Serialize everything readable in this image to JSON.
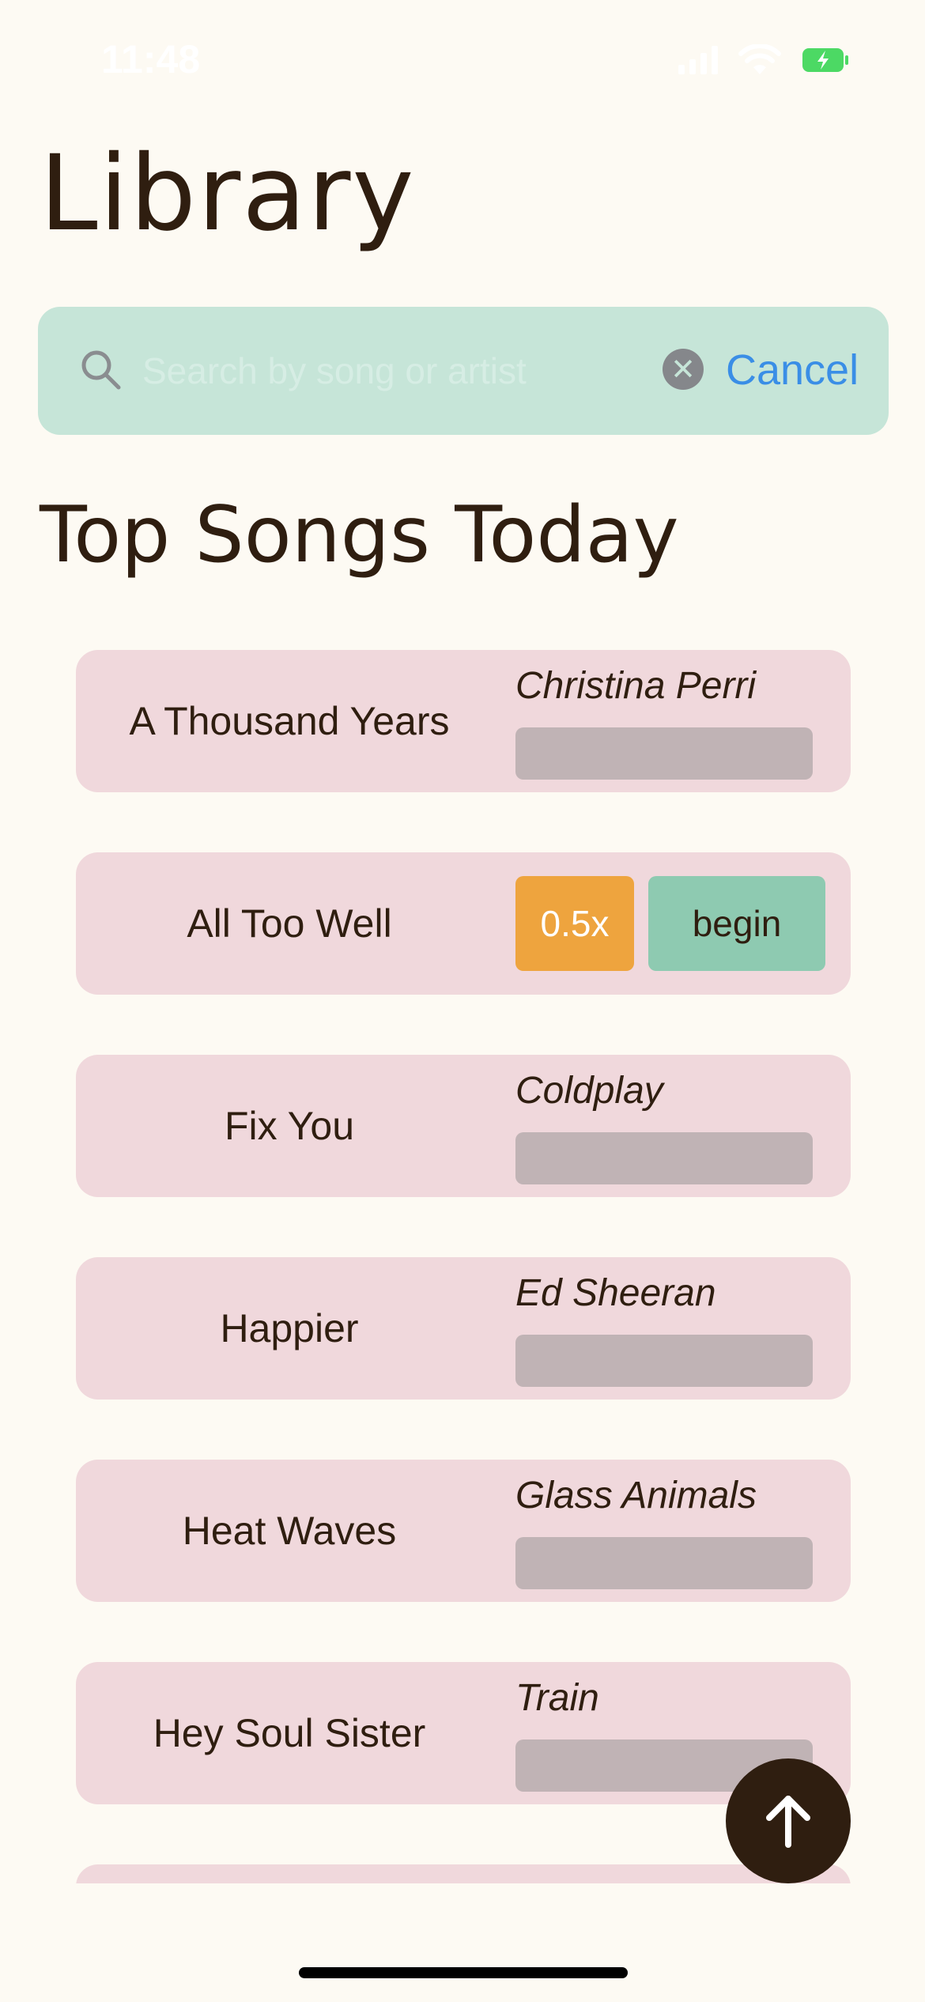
{
  "status_bar": {
    "time": "11:48",
    "signal_icon": "cellular-signal-icon",
    "wifi_icon": "wifi-icon",
    "battery_icon": "battery-charging-icon",
    "battery_color": "#4cd964"
  },
  "header": {
    "title": "Library"
  },
  "search": {
    "placeholder": "Search by song or artist",
    "value": "",
    "search_icon": "search-icon",
    "clear_icon": "clear-icon",
    "cancel_label": "Cancel",
    "background_color": "#c6e5d8",
    "cancel_color": "#3a8ee6"
  },
  "section": {
    "title": "Top Songs Today"
  },
  "songs": [
    {
      "title": "A Thousand Years",
      "artist": "Christina Perri"
    },
    {
      "title": "All Too Well",
      "expanded": true,
      "speed_label": "0.5x",
      "begin_label": "begin"
    },
    {
      "title": "Fix You",
      "artist": "Coldplay"
    },
    {
      "title": "Happier",
      "artist": "Ed Sheeran"
    },
    {
      "title": "Heat Waves",
      "artist": "Glass Animals"
    },
    {
      "title": "Hey Soul Sister",
      "artist": "Train"
    }
  ],
  "colors": {
    "background": "#fdfaf3",
    "card": "#f0d8dc",
    "text": "#2f1e10",
    "progress_track": "#c0b3b5",
    "speed_button": "#eea43e",
    "begin_button": "#8ecab1",
    "fab": "#2f1e10"
  },
  "scroll_top_button": {
    "icon": "arrow-up-icon"
  }
}
